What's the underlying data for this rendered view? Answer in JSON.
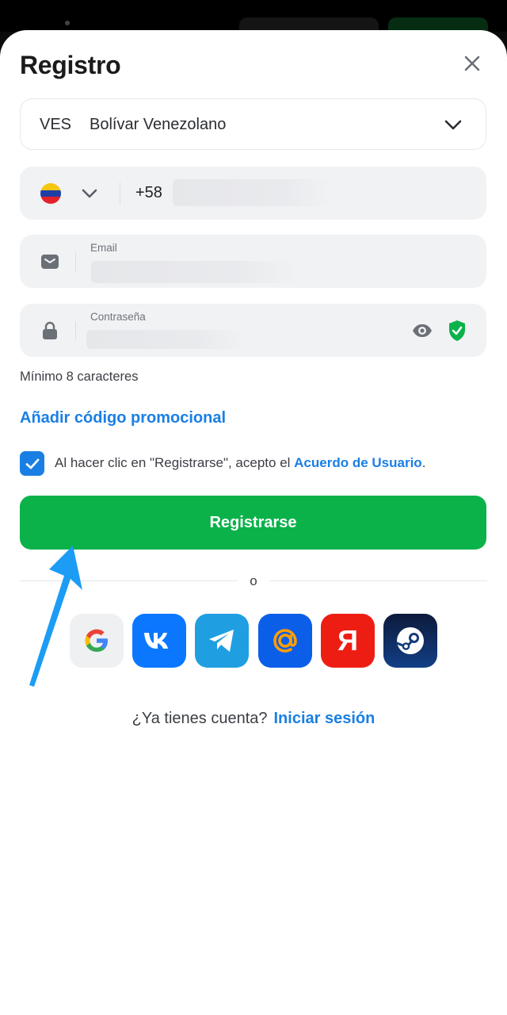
{
  "header": {
    "title": "Registro",
    "close_icon": "close-icon"
  },
  "currency": {
    "code": "VES",
    "name": "Bolívar Venezolano"
  },
  "phone": {
    "country_code": "+58",
    "flag": "venezuela-flag"
  },
  "email": {
    "label": "Email"
  },
  "password": {
    "label": "Contraseña",
    "hint": "Mínimo 8 caracteres"
  },
  "promo": {
    "label": "Añadir código promocional"
  },
  "agreement": {
    "checked": true,
    "text": "Al hacer clic en \"Registrarse\", acepto el ",
    "link": "Acuerdo de Usuario",
    "suffix": "."
  },
  "register_button": {
    "label": "Registrarse"
  },
  "divider": {
    "label": "o"
  },
  "social": [
    "google",
    "vk",
    "telegram",
    "mail-ru",
    "yandex",
    "steam"
  ],
  "login": {
    "prompt": "¿Ya tienes cuenta?",
    "link": "Iniciar sesión"
  },
  "colors": {
    "accent": "#1a7fe4",
    "primary_button": "#0bb24a",
    "field_bg": "#f1f2f4"
  }
}
